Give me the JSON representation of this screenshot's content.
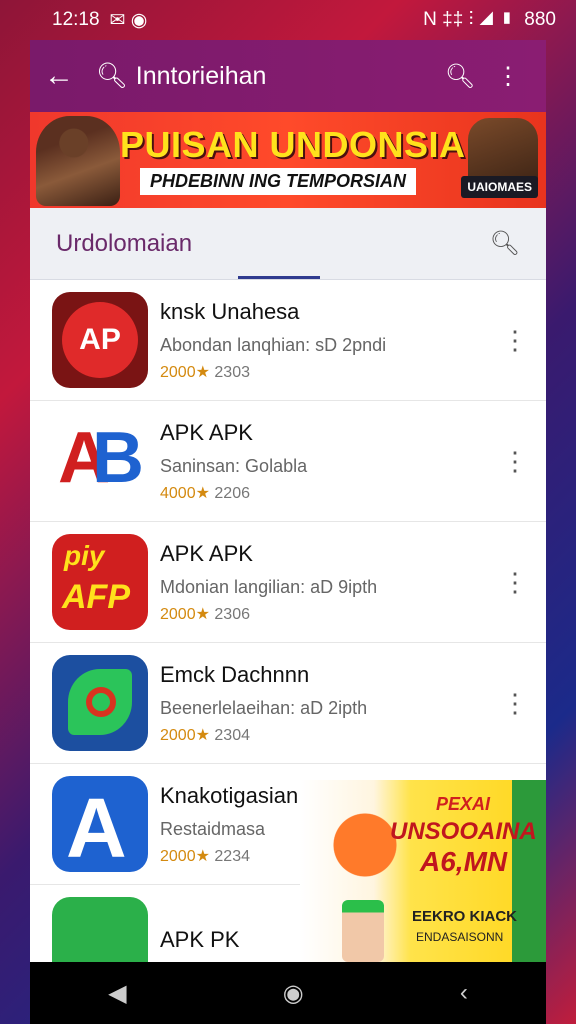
{
  "status": {
    "time": "12:18",
    "left_icons": "✉ ◉",
    "right_icons": "N ‡‡ ⫶ ◢ ▮",
    "battery": "880"
  },
  "appbar": {
    "title": "Inntorieihan"
  },
  "banner": {
    "title": "PUISAN UNDONSIA",
    "subtitle": "PHDEBINN ING TEMPORSIAN",
    "tag": "UAIOMAES"
  },
  "tabs": {
    "label": "Urdolomaian"
  },
  "apps": [
    {
      "name": "knsk Unahesa",
      "sub": "Abondan lanqhian: sD 2pndi",
      "rating": "2000★",
      "count": "2303",
      "icon_text": "AP"
    },
    {
      "name": "APK APK",
      "sub": "Saninsan: Golabla",
      "rating": "4000★",
      "count": "2206",
      "icon_text": "AB"
    },
    {
      "name": "APK APK",
      "sub": "Mdonian langilian: aD 9ipth",
      "rating": "2000★",
      "count": "2306",
      "icon_text": "piy AFP"
    },
    {
      "name": "Emck Dachnnn",
      "sub": "Beenerlelaeihan: aD 2ipth",
      "rating": "2000★",
      "count": "2304",
      "icon_text": ""
    },
    {
      "name": "Knakotigasian",
      "sub": "Restaidmasa",
      "rating": "2000★",
      "count": "2234",
      "icon_text": "A"
    },
    {
      "name": "APK PK",
      "sub": "",
      "rating": "",
      "count": "",
      "icon_text": ""
    }
  ],
  "promo": {
    "line1": "PEXAI",
    "line2": "UNSOOAINA",
    "line3": "A6,MN",
    "line4": "EEKRO KIACK",
    "line5": "ENDASAISONN"
  },
  "icons": [
    "arrow-left-icon",
    "search-icon",
    "more-vertical-icon",
    "nav-back-icon",
    "nav-home-icon",
    "nav-recents-icon"
  ],
  "colors": {
    "appbar": "#7a1a6a",
    "banner": "#f0382c",
    "tab_indicator": "#2f3b8f",
    "rating": "#d48a10"
  }
}
